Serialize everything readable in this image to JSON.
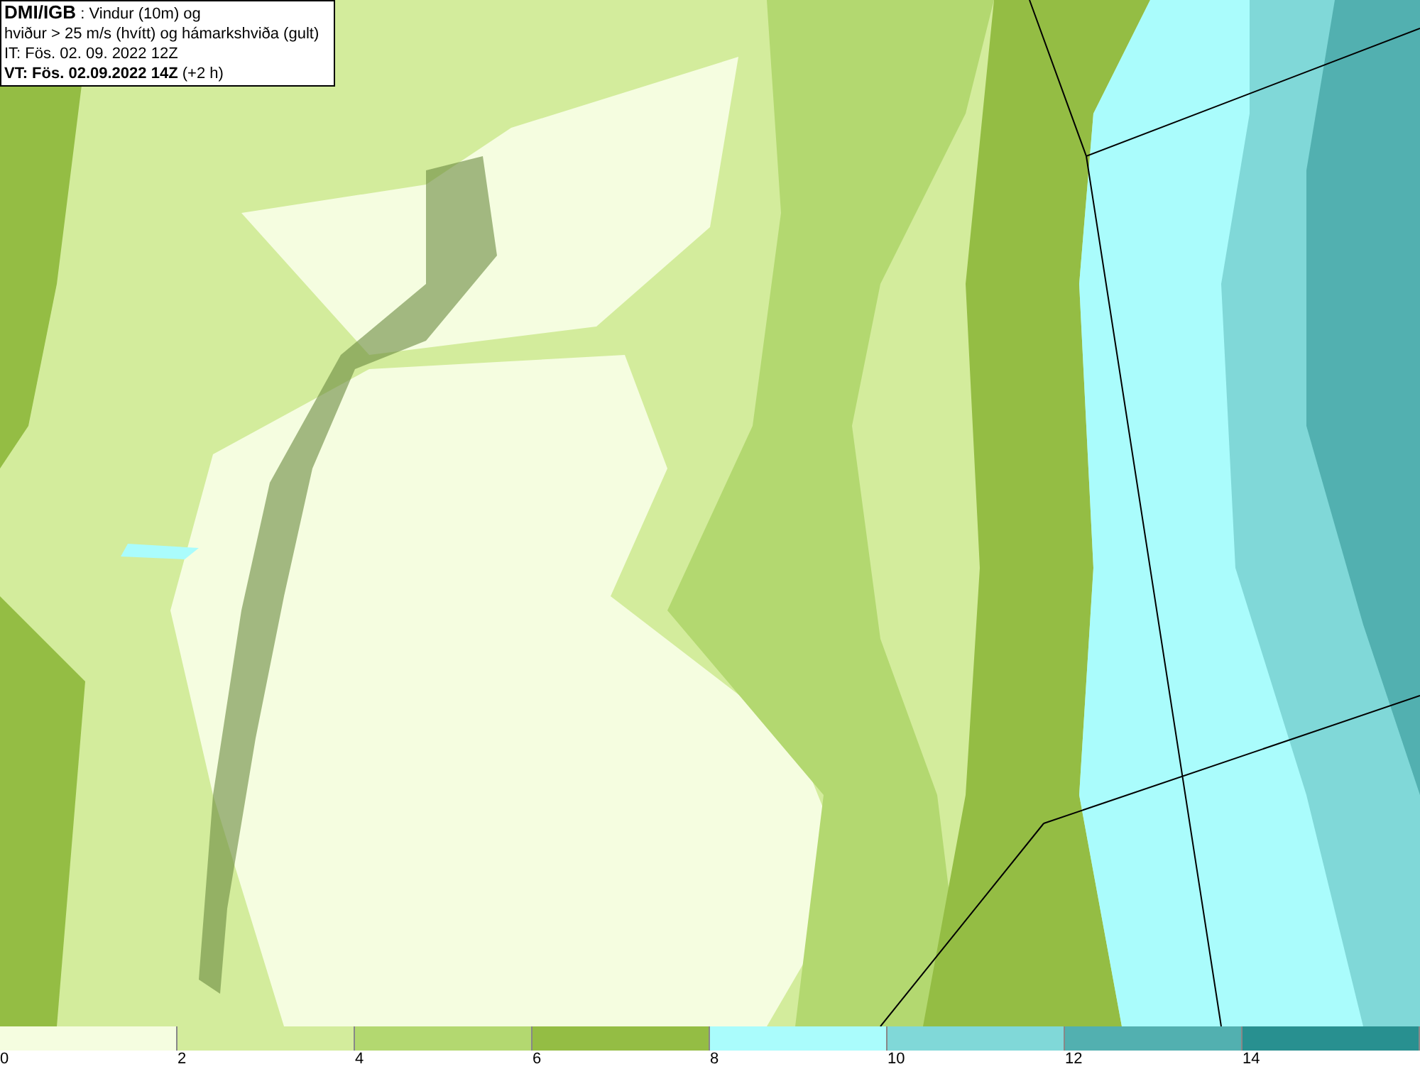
{
  "info_box": {
    "source": "DMI/IGB",
    "lines": [
      " : Vindur (10m) og",
      "hviður > 25 m/s (hvítt) og hámarkshviða (gult)",
      "IT: Fös. 02. 09. 2022 12Z"
    ],
    "valid_time": "VT: Fös. 02.09.2022 14Z",
    "valid_offset": " (+2 h)"
  },
  "legend": {
    "bins": [
      {
        "color": "#f5fde0"
      },
      {
        "color": "#d3ec9c"
      },
      {
        "color": "#b3d870"
      },
      {
        "color": "#94bd44"
      },
      {
        "color": "#aafcfc"
      },
      {
        "color": "#80d8d8"
      },
      {
        "color": "#52b0b0"
      },
      {
        "color": "#289090"
      }
    ],
    "labels": [
      "0",
      "2",
      "4",
      "6",
      "8",
      "10",
      "12",
      "14"
    ]
  }
}
